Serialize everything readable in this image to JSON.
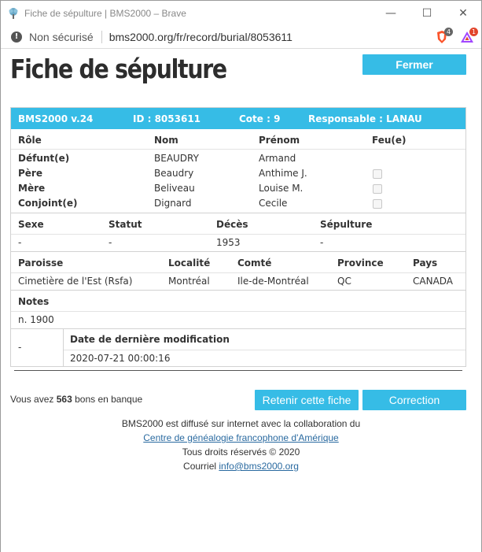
{
  "window": {
    "title": "Fiche de sépulture | BMS2000 – Brave",
    "minimize": "—",
    "maximize": "☐",
    "close": "✕"
  },
  "addressbar": {
    "security_text": "Non sécurisé",
    "url": "bms2000.org/fr/record/burial/8053611",
    "brave_badge": "4",
    "rewards_badge": "1"
  },
  "page": {
    "title": "Fiche de sépulture",
    "close_button": "Fermer"
  },
  "record": {
    "header": {
      "version": "BMS2000 v.24",
      "id": "ID : 8053611",
      "cote": "Cote : 9",
      "responsable": "Responsable : LANAU"
    },
    "persons": {
      "columns": [
        "Rôle",
        "Nom",
        "Prénom",
        "Feu(e)"
      ],
      "rows": [
        {
          "role": "Défunt(e)",
          "nom": "BEAUDRY",
          "prenom": "Armand"
        },
        {
          "role": "Père",
          "nom": "Beaudry",
          "prenom": "Anthime J."
        },
        {
          "role": "Mère",
          "nom": "Beliveau",
          "prenom": "Louise M."
        },
        {
          "role": "Conjoint(e)",
          "nom": "Dignard",
          "prenom": "Cecile"
        }
      ]
    },
    "status": {
      "columns": [
        "Sexe",
        "Statut",
        "Décès",
        "Sépulture"
      ],
      "values": [
        "-",
        "-",
        "1953",
        "-"
      ]
    },
    "location": {
      "columns": [
        "Paroisse",
        "Localité",
        "Comté",
        "Province",
        "Pays"
      ],
      "values": [
        "Cimetière de l'Est (Rsfa)",
        "Montréal",
        "Ile-de-Montréal",
        "QC",
        "CANADA"
      ]
    },
    "notes": {
      "label": "Notes",
      "value": "n. 1900"
    },
    "modification": {
      "left": "-",
      "label": "Date de dernière modification",
      "value": "2020-07-21 00:00:16"
    }
  },
  "bank": {
    "prefix": "Vous avez",
    "count": "563",
    "suffix": "bons en banque"
  },
  "actions": {
    "retain": "Retenir cette fiche",
    "correction": "Correction"
  },
  "footer": {
    "line1": "BMS2000 est diffusé sur internet avec la collaboration du",
    "link1": "Centre de généalogie francophone d'Amérique",
    "line3": "Tous droits réservés © 2020",
    "courriel_label": "Courriel",
    "email": "info@bms2000.org"
  },
  "colors": {
    "accent": "#36bce6",
    "link": "#2a6aa0"
  }
}
